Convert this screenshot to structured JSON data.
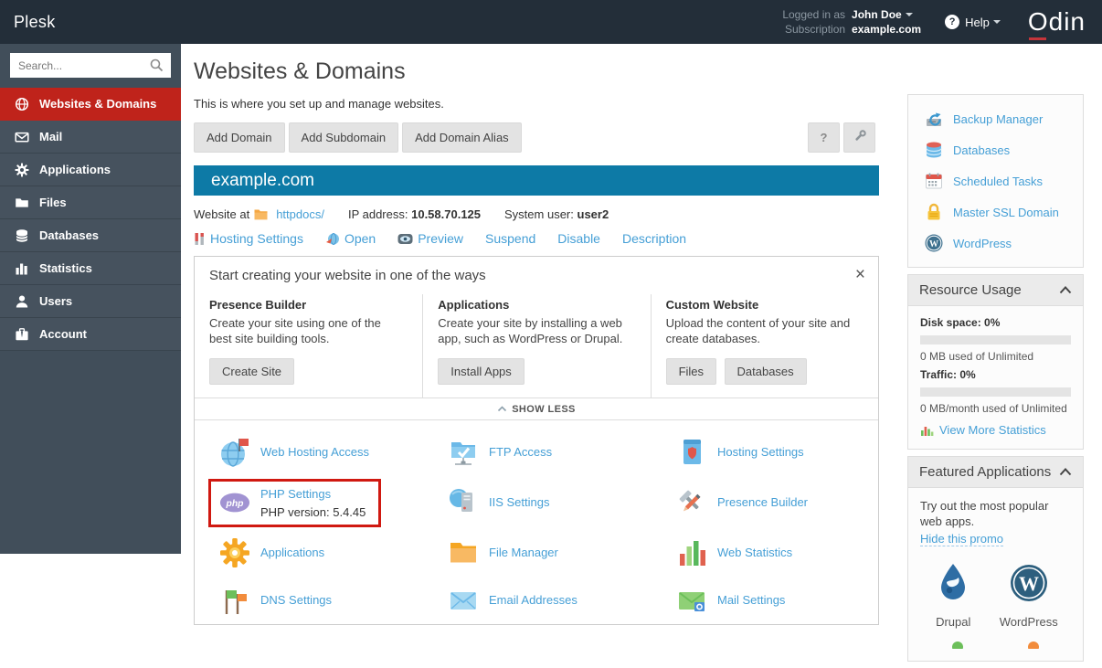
{
  "colors": {
    "topbar_bg": "#232e39",
    "sidebar_bg": "#46525e",
    "active_red": "#bf231b",
    "banner_blue": "#0d7aa6",
    "link_blue": "#459fd6",
    "highlight_red": "#d01911"
  },
  "topbar": {
    "brand": "Plesk",
    "logged_in_as_label": "Logged in as",
    "user": "John Doe",
    "subscription_label": "Subscription",
    "subscription": "example.com",
    "help_label": "Help",
    "help_icon": "question-circle-icon",
    "logo": "Odin"
  },
  "sidebar": {
    "search_placeholder": "Search...",
    "search_icon": "search-icon",
    "items": [
      {
        "label": "Websites & Domains",
        "icon": "globe-icon",
        "active": true
      },
      {
        "label": "Mail",
        "icon": "mail-icon"
      },
      {
        "label": "Applications",
        "icon": "gear-icon"
      },
      {
        "label": "Files",
        "icon": "folder-icon"
      },
      {
        "label": "Databases",
        "icon": "database-icon"
      },
      {
        "label": "Statistics",
        "icon": "bar-chart-icon"
      },
      {
        "label": "Users",
        "icon": "user-icon"
      },
      {
        "label": "Account",
        "icon": "briefcase-icon"
      }
    ]
  },
  "main": {
    "title": "Websites & Domains",
    "subtitle": "This is where you set up and manage websites.",
    "actions": [
      "Add Domain",
      "Add Subdomain",
      "Add Domain Alias"
    ],
    "help_button": "?",
    "wrench_button_icon": "wrench-icon",
    "domain": {
      "name": "example.com",
      "website_at_label": "Website at",
      "docroot_icon": "folder-icon",
      "docroot": "httpdocs/",
      "ip_label": "IP address:",
      "ip": "10.58.70.125",
      "sysuser_label": "System user:",
      "sysuser": "user2",
      "links": [
        "Hosting Settings",
        "Open",
        "Preview",
        "Suspend",
        "Disable",
        "Description"
      ]
    },
    "promo": {
      "title": "Start creating your website in one of the ways",
      "close_icon": "close-icon",
      "columns": [
        {
          "title": "Presence Builder",
          "text": "Create your site using one of the best site building tools.",
          "buttons": [
            "Create Site"
          ]
        },
        {
          "title": "Applications",
          "text": "Create your site by installing a web app, such as WordPress or Drupal.",
          "buttons": [
            "Install Apps"
          ]
        },
        {
          "title": "Custom Website",
          "text": "Upload the content of your site and create databases.",
          "buttons": [
            "Files",
            "Databases"
          ]
        }
      ],
      "toggle": "SHOW LESS",
      "toggle_icon": "chevron-up-icon"
    },
    "tools": [
      {
        "label": "Web Hosting Access",
        "icon": "web-hosting-access-icon"
      },
      {
        "label": "FTP Access",
        "icon": "ftp-access-icon"
      },
      {
        "label": "Hosting Settings",
        "icon": "hosting-settings-icon"
      },
      {
        "label": "PHP Settings",
        "sub": "PHP version: 5.4.45",
        "icon": "php-icon",
        "highlighted": true
      },
      {
        "label": "IIS Settings",
        "icon": "iis-icon"
      },
      {
        "label": "Presence Builder",
        "icon": "presence-builder-icon"
      },
      {
        "label": "Applications",
        "icon": "gear-orange-icon"
      },
      {
        "label": "File Manager",
        "icon": "folder-orange-icon"
      },
      {
        "label": "Web Statistics",
        "icon": "web-statistics-icon"
      },
      {
        "label": "DNS Settings",
        "icon": "dns-flags-icon"
      },
      {
        "label": "Email Addresses",
        "icon": "envelope-blue-icon"
      },
      {
        "label": "Mail Settings",
        "icon": "envelope-green-icon"
      }
    ]
  },
  "rail": {
    "quick_links": [
      {
        "label": "Backup Manager",
        "icon": "backup-drive-icon"
      },
      {
        "label": "Databases",
        "icon": "database-color-icon"
      },
      {
        "label": "Scheduled Tasks",
        "icon": "calendar-icon"
      },
      {
        "label": "Master SSL Domain",
        "icon": "lock-icon"
      },
      {
        "label": "WordPress",
        "icon": "wordpress-icon"
      }
    ],
    "resource_usage": {
      "title": "Resource Usage",
      "collapse_icon": "chevron-up-icon",
      "disk_label": "Disk space: 0%",
      "disk_pct": 0,
      "disk_note": "0 MB used of Unlimited",
      "traffic_label": "Traffic: 0%",
      "traffic_pct": 0,
      "traffic_note": "0 MB/month used of Unlimited",
      "stats_link": "View More Statistics",
      "stats_icon": "mini-bar-chart-icon"
    },
    "featured": {
      "title": "Featured Applications",
      "collapse_icon": "chevron-up-icon",
      "text": "Try out the most popular web apps.",
      "hide_link": "Hide this promo",
      "apps": [
        {
          "label": "Drupal",
          "icon": "drupal-icon"
        },
        {
          "label": "WordPress",
          "icon": "wordpress-icon"
        }
      ]
    }
  }
}
